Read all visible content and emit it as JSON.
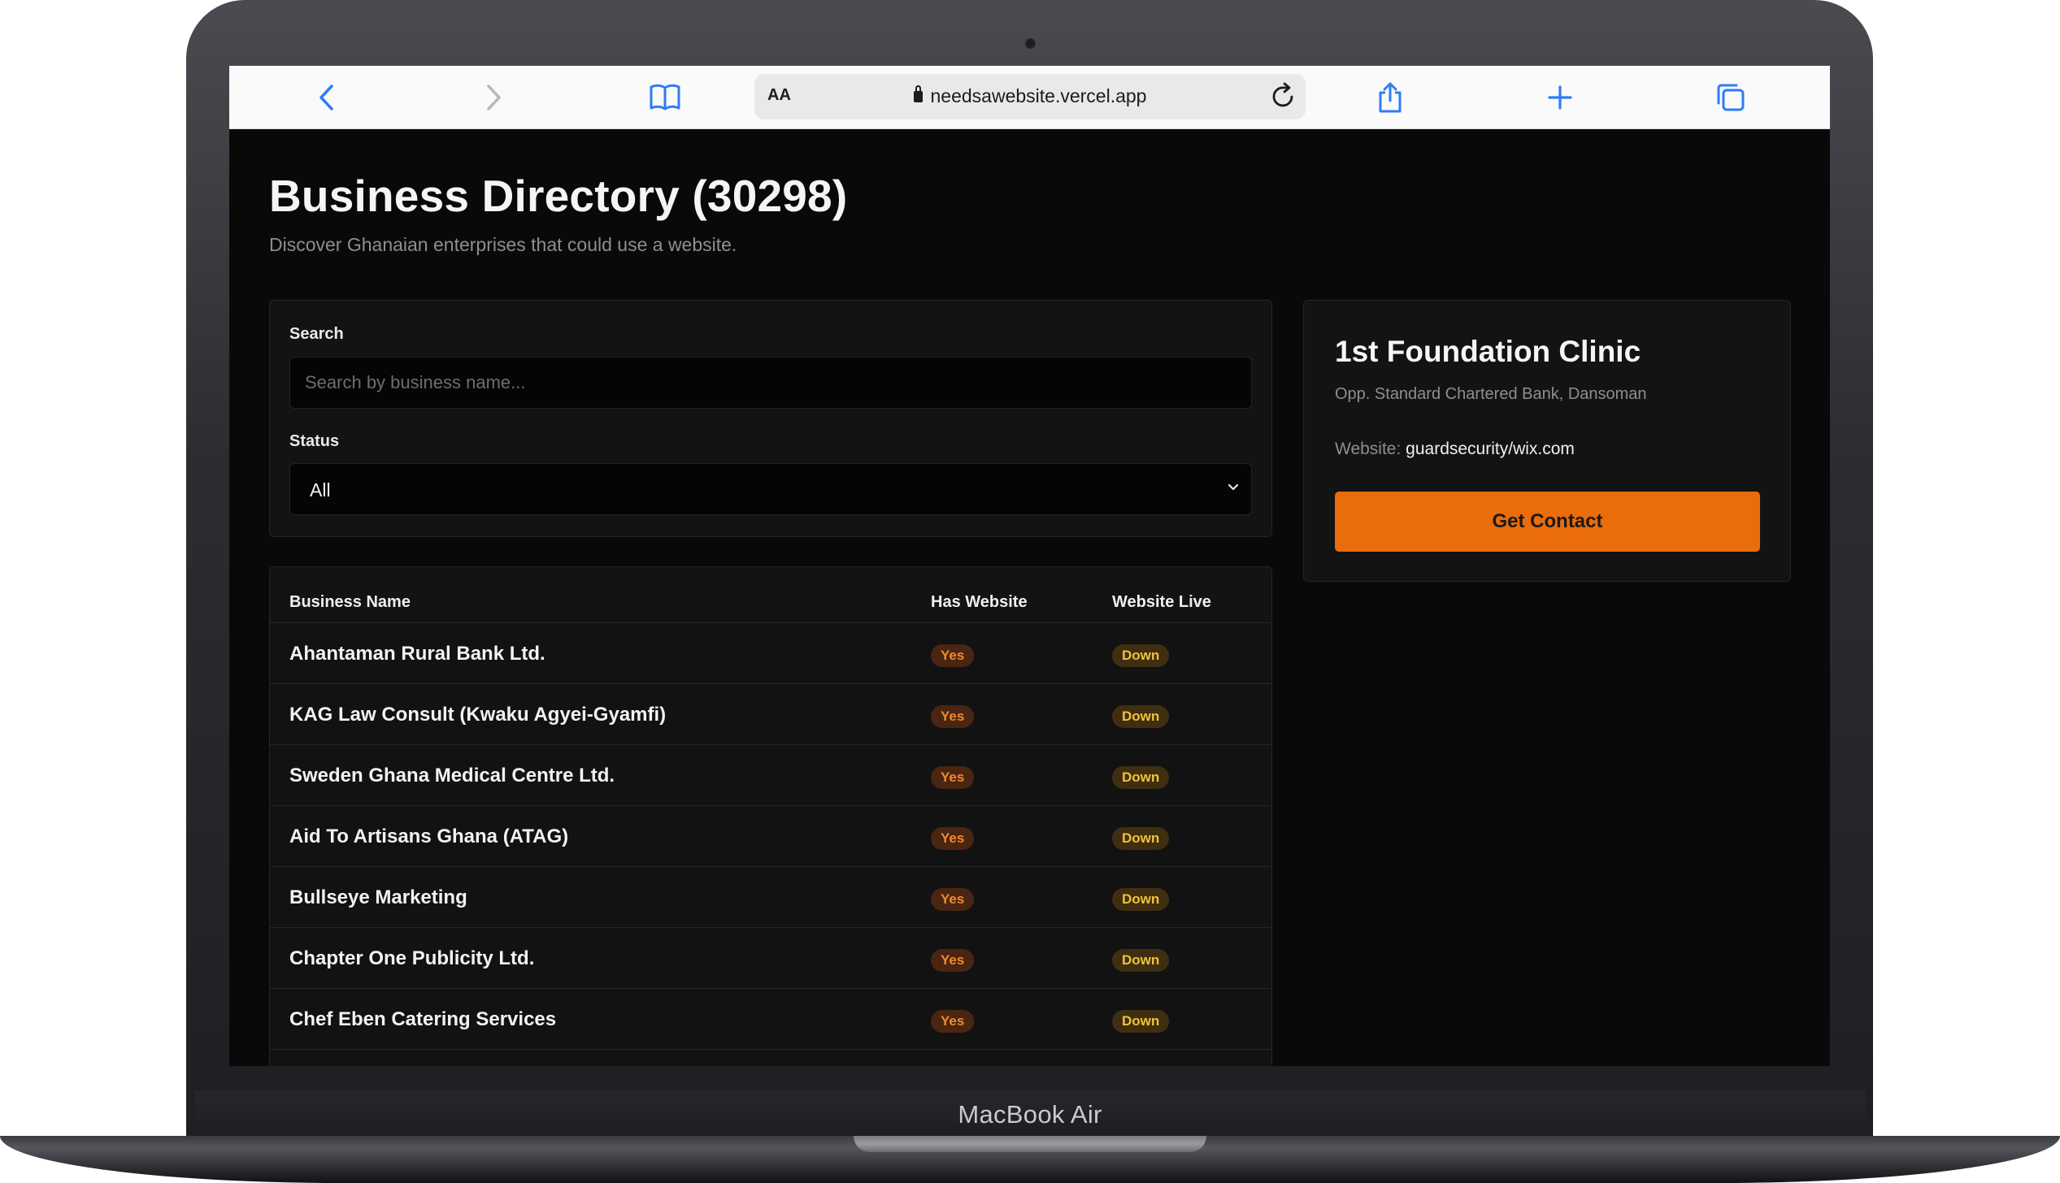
{
  "device": {
    "label": "MacBook Air"
  },
  "browser": {
    "url": "needsawebsite.vercel.app",
    "reader_label": "AA",
    "icons": {
      "back": "chevron-left-icon",
      "forward": "chevron-right-icon",
      "bookmarks": "book-icon",
      "reload": "reload-icon",
      "share": "share-icon",
      "new_tab": "plus-icon",
      "tabs": "tabs-icon"
    },
    "accent": "#2f7cf6"
  },
  "page": {
    "title": "Business Directory (30298)",
    "subtitle": "Discover Ghanaian enterprises that could use a website."
  },
  "filters": {
    "search_label": "Search",
    "search_placeholder": "Search by business name...",
    "search_value": "",
    "status_label": "Status",
    "status_value": "All"
  },
  "table": {
    "columns": [
      "Business Name",
      "Has Website",
      "Website Live"
    ],
    "rows": [
      {
        "name": "Ahantaman Rural Bank Ltd.",
        "has_website": "Yes",
        "website_live": "Down"
      },
      {
        "name": "KAG Law Consult (Kwaku Agyei-Gyamfi)",
        "has_website": "Yes",
        "website_live": "Down"
      },
      {
        "name": "Sweden Ghana Medical Centre Ltd.",
        "has_website": "Yes",
        "website_live": "Down"
      },
      {
        "name": "Aid To Artisans Ghana (ATAG)",
        "has_website": "Yes",
        "website_live": "Down"
      },
      {
        "name": "Bullseye Marketing",
        "has_website": "Yes",
        "website_live": "Down"
      },
      {
        "name": "Chapter One Publicity Ltd.",
        "has_website": "Yes",
        "website_live": "Down"
      },
      {
        "name": "Chef Eben Catering Services",
        "has_website": "Yes",
        "website_live": "Down"
      }
    ]
  },
  "detail": {
    "name": "1st Foundation Clinic",
    "address": "Opp. Standard Chartered Bank, Dansoman",
    "website_label": "Website:",
    "website_value": "guardsecurity/wix.com",
    "button_label": "Get Contact"
  },
  "colors": {
    "background": "#090909",
    "accent_button": "#ea6c0a",
    "badge_yes_bg": "#4a2512",
    "badge_yes_text": "#f08a2a",
    "badge_down_bg": "#3f2f10",
    "badge_down_text": "#f0c23a"
  }
}
